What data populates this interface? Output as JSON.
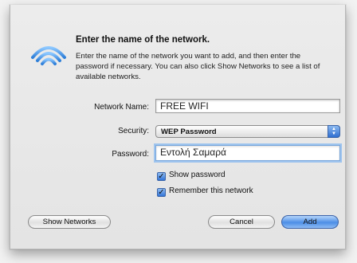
{
  "dialog": {
    "title": "Enter the name of the network.",
    "description": "Enter the name of the network you want to add, and then enter the password if necessary. You can also click Show Networks to see a list of available networks."
  },
  "form": {
    "network_name_label": "Network Name:",
    "network_name_value": "FREE WIFI",
    "security_label": "Security:",
    "security_value": "WEP Password",
    "password_label": "Password:",
    "password_value": "Εντολή Σαμαρά"
  },
  "options": {
    "show_password": {
      "label": "Show password",
      "checked": true
    },
    "remember_network": {
      "label": "Remember this network",
      "checked": true
    }
  },
  "buttons": {
    "show_networks": "Show Networks",
    "cancel": "Cancel",
    "add": "Add"
  },
  "icons": {
    "wifi": "wifi-icon",
    "popup_arrows": "popup-arrows-icon",
    "checkmark": "checkmark-icon"
  },
  "colors": {
    "accent": "#3374d6",
    "wifi_blue": "#4a9ee8"
  }
}
